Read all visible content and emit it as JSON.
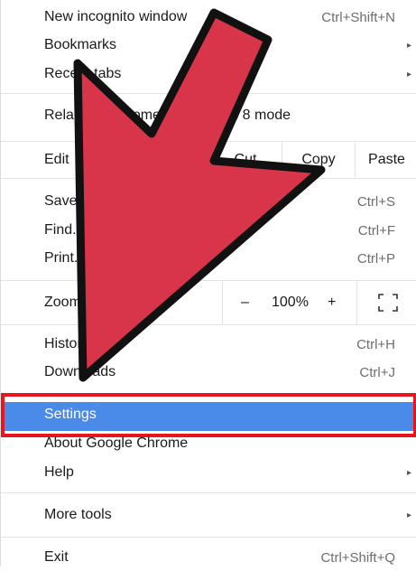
{
  "menu": {
    "new_incognito": {
      "label": "New incognito window",
      "shortcut": "Ctrl+Shift+N"
    },
    "bookmarks": {
      "label": "Bookmarks"
    },
    "recent_tabs": {
      "label": "Recent tabs"
    },
    "relaunch": {
      "label": "Relaunch Chrome in Windows 8 mode"
    },
    "edit": {
      "label": "Edit",
      "cut": "Cut",
      "copy": "Copy",
      "paste": "Paste"
    },
    "save": {
      "label": "Save page as...",
      "shortcut": "Ctrl+S"
    },
    "find": {
      "label": "Find...",
      "shortcut": "Ctrl+F"
    },
    "print": {
      "label": "Print...",
      "shortcut": "Ctrl+P"
    },
    "zoom": {
      "label": "Zoom",
      "minus": "–",
      "value": "100%",
      "plus": "+"
    },
    "history": {
      "label": "History",
      "shortcut": "Ctrl+H"
    },
    "downloads": {
      "label": "Downloads",
      "shortcut": "Ctrl+J"
    },
    "settings": {
      "label": "Settings"
    },
    "about": {
      "label": "About Google Chrome"
    },
    "help": {
      "label": "Help"
    },
    "more_tools": {
      "label": "More tools"
    },
    "exit": {
      "label": "Exit",
      "shortcut": "Ctrl+Shift+Q"
    }
  },
  "icons": {
    "submenu_arrow": "▸",
    "fullscreen": "fullscreen-icon",
    "pointer": "pointer-arrow-icon"
  },
  "colors": {
    "highlight": "#4a8ae8",
    "highlight_border": "#e8141f",
    "arrow_fill": "#d9354a",
    "arrow_stroke": "#111111"
  }
}
